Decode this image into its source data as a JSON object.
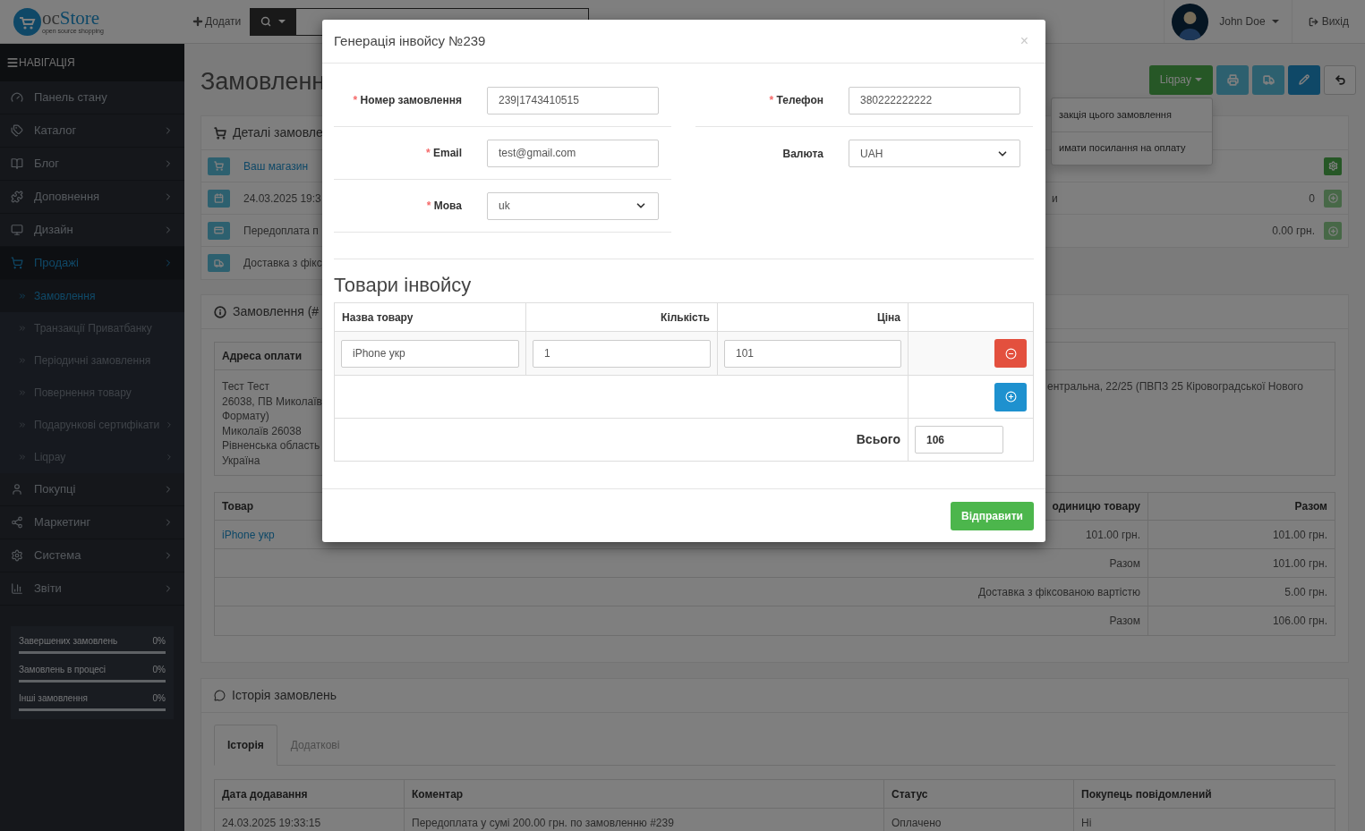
{
  "header": {
    "logo": {
      "part_1": "oc",
      "part_2": "Store",
      "tagline": "open source shopping"
    },
    "add_button": "Додати",
    "user": "John Doe",
    "logout": "Вихід"
  },
  "sidebar": {
    "title": "НАВІГАЦІЯ",
    "items": [
      {
        "label": "Панель стану",
        "kind": "link",
        "selected": false
      },
      {
        "label": "Каталог",
        "kind": "submenu",
        "selected": false
      },
      {
        "label": "Блог",
        "kind": "submenu",
        "selected": false
      },
      {
        "label": "Доповнення",
        "kind": "submenu",
        "selected": false
      },
      {
        "label": "Дизайн",
        "kind": "submenu",
        "selected": false
      },
      {
        "label": "Продажі",
        "kind": "submenu",
        "selected": true,
        "children": [
          {
            "label": "Замовлення",
            "kind": "link",
            "selected": true
          },
          {
            "label": "Транзакції Приватбанку",
            "kind": "link",
            "selected": false
          },
          {
            "label": "Періодичні замовлення",
            "kind": "link",
            "selected": false
          },
          {
            "label": "Повернення товару",
            "kind": "link",
            "selected": false
          },
          {
            "label": "Подарункові сертифікати",
            "kind": "submenu",
            "selected": false
          },
          {
            "label": "Liqpay",
            "kind": "submenu",
            "selected": false
          }
        ]
      },
      {
        "label": "Покупці",
        "kind": "submenu",
        "selected": false
      },
      {
        "label": "Маркетинг",
        "kind": "submenu",
        "selected": false
      },
      {
        "label": "Система",
        "kind": "submenu",
        "selected": false
      },
      {
        "label": "Звіти",
        "kind": "submenu",
        "selected": false
      }
    ],
    "stats": [
      {
        "label": "Завершених замовлень",
        "value": "0%",
        "level": 0
      },
      {
        "label": "Замовлень в процесі",
        "value": "0%",
        "level": 0
      },
      {
        "label": "Інші замовлення",
        "value": "0%",
        "level": 0
      }
    ]
  },
  "page": {
    "title": "Замовленн",
    "liqpay_button": "Liqpay",
    "liqpay_menu": [
      "закція цього замовлення",
      "имати посилання на оплату"
    ]
  },
  "details": {
    "title": "Деталі замовле",
    "rows": [
      {
        "kind": "link",
        "text": "Ваш магазин"
      },
      {
        "kind": "text",
        "text": "24.03.2025 19:3"
      },
      {
        "kind": "text",
        "text": "Передоплата п"
      },
      {
        "kind": "text",
        "text": "Доставка з фікс"
      }
    ]
  },
  "options": {
    "rows": [
      {
        "kind": "settings"
      },
      {
        "kind": "add",
        "label": "и",
        "value": "0"
      },
      {
        "kind": "add",
        "value": "0.00 грн."
      }
    ]
  },
  "order": {
    "title": "Замовлення (#",
    "address_header": "Адреса оплати",
    "payment_address": [
      "Тест Тест",
      "26038, ПВ Миколаїв",
      "Формату)",
      "Миколаїв 26038",
      "Рівненська область",
      "Україна"
    ],
    "shipping_address": "ентральна, 22/25 (ПВПЗ 25 Кіровоградської Нового",
    "products_header": {
      "product": "Товар",
      "unit_price": "одиницю товару",
      "total": "Разом"
    },
    "product": {
      "name": "iPhone укр",
      "unit_price": "101.00 грн.",
      "total": "101.00 грн."
    },
    "totals": [
      {
        "label": "Разом",
        "value": "101.00 грн."
      },
      {
        "label": "Доставка з фіксованою вартістю",
        "value": "5.00 грн."
      },
      {
        "label": "Разом",
        "value": "106.00 грн."
      }
    ]
  },
  "history": {
    "title": "Історія замовлень",
    "tabs": [
      {
        "label": "Історія",
        "selected": true
      },
      {
        "label": "Додаткові",
        "selected": false
      }
    ],
    "columns": [
      "Дата додавання",
      "Коментар",
      "Статус",
      "Покупець повідомлений"
    ],
    "rows": [
      [
        "24.03.2025 19:33:15",
        "Передоплата у сумі 200.00 грн. по замовленню #239",
        "Оплачено",
        "Ні"
      ]
    ]
  },
  "modal": {
    "title": "Генерація інвойсу №239",
    "close": "×",
    "required_mark": "*",
    "left_fields": [
      {
        "label": "Номер замовлення",
        "required": true,
        "kind": "text",
        "value": "239|1743410515"
      },
      {
        "label": "Email",
        "required": true,
        "kind": "text",
        "value": "test@gmail.com"
      },
      {
        "label": "Мова",
        "required": true,
        "kind": "select",
        "value": "uk"
      }
    ],
    "right_fields": [
      {
        "label": "Телефон",
        "required": true,
        "kind": "text",
        "value": "380222222222"
      },
      {
        "label": "Валюта",
        "required": false,
        "kind": "select",
        "value": "UAH"
      }
    ],
    "section_title": "Товари інвойсу",
    "columns": [
      "Назва товару",
      "Кількість",
      "Ціна"
    ],
    "items": [
      {
        "name": "iPhone укр",
        "quantity": "1",
        "price": "101"
      }
    ],
    "total_label": "Всього",
    "total": "106",
    "submit": "Відправити"
  }
}
